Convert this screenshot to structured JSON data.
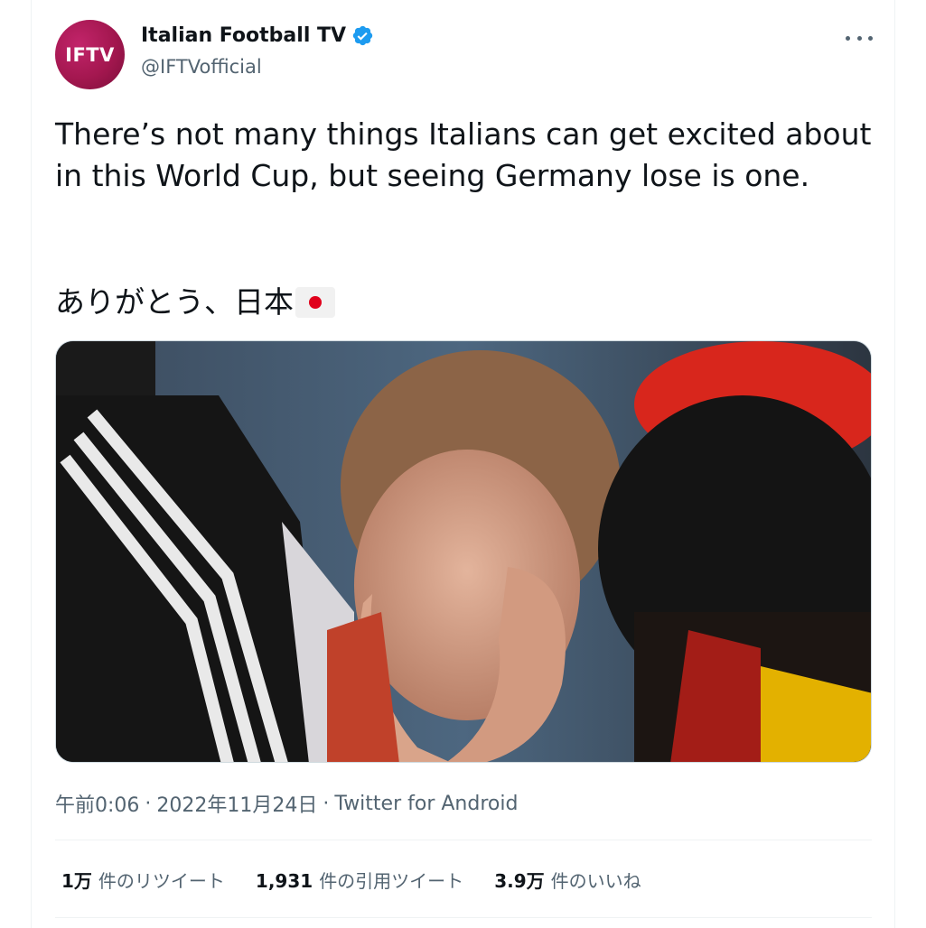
{
  "author": {
    "avatar_text": "IFTV",
    "name": "Italian Football TV",
    "handle": "@IFTVofficial",
    "verified": true,
    "avatar_color": "#a3174f"
  },
  "tweet": {
    "text": "There’s not many things Italians can get excited about in this World Cup, but seeing Germany lose is one.",
    "text_jp": "ありがとう、日本",
    "flag_icon": "japan-flag-icon"
  },
  "media": {
    "alt": ""
  },
  "meta": {
    "time": "午前0:06",
    "date": "2022年11月24日",
    "source": "Twitter for Android",
    "separator": "·"
  },
  "stats": {
    "retweets_count": "1万",
    "retweets_label": "件のリツイート",
    "quotes_count": "1,931",
    "quotes_label": "件の引用ツイート",
    "likes_count": "3.9万",
    "likes_label": "件のいいね"
  },
  "colors": {
    "verified": "#1d9bf0",
    "secondary_text": "#536471",
    "primary_text": "#0f1419"
  }
}
